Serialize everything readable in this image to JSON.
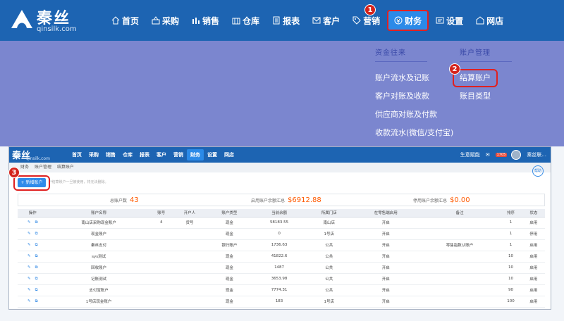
{
  "brand": {
    "name": "秦丝",
    "domain": "qinsilk.com"
  },
  "nav": {
    "items": [
      {
        "label": "首页",
        "icon": "home-icon"
      },
      {
        "label": "采购",
        "icon": "basket-icon"
      },
      {
        "label": "销售",
        "icon": "sales-icon"
      },
      {
        "label": "仓库",
        "icon": "warehouse-icon"
      },
      {
        "label": "报表",
        "icon": "report-icon"
      },
      {
        "label": "客户",
        "icon": "mail-icon"
      },
      {
        "label": "营销",
        "icon": "tag-icon"
      },
      {
        "label": "财务",
        "icon": "finance-icon"
      },
      {
        "label": "设置",
        "icon": "settings-icon"
      },
      {
        "label": "网店",
        "icon": "shop-icon"
      }
    ]
  },
  "dropdown": {
    "col1": {
      "title": "资金往来",
      "links": [
        "账户流水及记账",
        "客户对账及收款",
        "供应商对账及付款",
        "收款流水(微信/支付宝)"
      ]
    },
    "col2": {
      "title": "账户管理",
      "links": [
        "结算账户",
        "账目类型"
      ]
    }
  },
  "badges": [
    "1",
    "2",
    "3"
  ],
  "mini": {
    "brand": "秦丝",
    "domain": "qinsilk.com",
    "user_label": "生意赋能",
    "notice_badge": "1705",
    "user_name": "秦丝联..."
  },
  "breadcrumb": [
    "财务",
    "账户管理",
    "结算账户"
  ],
  "help_label": "帮助",
  "add_button": "+ 新增账户",
  "hint_text": "*结算账户一旦被使用，将无法删除。",
  "summary": {
    "total_label": "总账户数",
    "total_value": "43",
    "enabled_label": "启用账户余额汇总",
    "enabled_value": "$6912.88",
    "disabled_label": "停用账户余额汇总",
    "disabled_value": "$0.00"
  },
  "table": {
    "headers": [
      "操作",
      "账户名称",
      "账号",
      "开户人",
      "账户类型",
      "当前余额",
      "所属门店",
      "在零售端启用",
      "备注",
      "排序",
      "状态"
    ],
    "rows": [
      [
        "",
        "南山店采购现金账户",
        "4",
        "货号",
        "现金",
        "58183.55",
        "南山店",
        "开启",
        "",
        "1",
        "启用"
      ],
      [
        "",
        "现金账户",
        "",
        "",
        "现金",
        "0",
        "1号店",
        "开启",
        "",
        "1",
        "停用"
      ],
      [
        "",
        "秦丝支付",
        "",
        "",
        "银行账户",
        "1736.63",
        "公共",
        "开启",
        "零售指数认账户",
        "1",
        "启用"
      ],
      [
        "",
        "sys测试",
        "",
        "",
        "现金",
        "41822.6",
        "公共",
        "开启",
        "",
        "10",
        "启用"
      ],
      [
        "",
        "回收账户",
        "",
        "",
        "现金",
        "1487",
        "公共",
        "开启",
        "",
        "10",
        "启用"
      ],
      [
        "",
        "记账测试",
        "",
        "",
        "现金",
        "3653.98",
        "公共",
        "开启",
        "",
        "10",
        "启用"
      ],
      [
        "",
        "支付宝账户",
        "",
        "",
        "现金",
        "7774.31",
        "公共",
        "开启",
        "",
        "90",
        "启用"
      ],
      [
        "",
        "1号店现金账户",
        "",
        "",
        "现金",
        "183",
        "1号店",
        "开启",
        "",
        "100",
        "启用"
      ]
    ]
  }
}
